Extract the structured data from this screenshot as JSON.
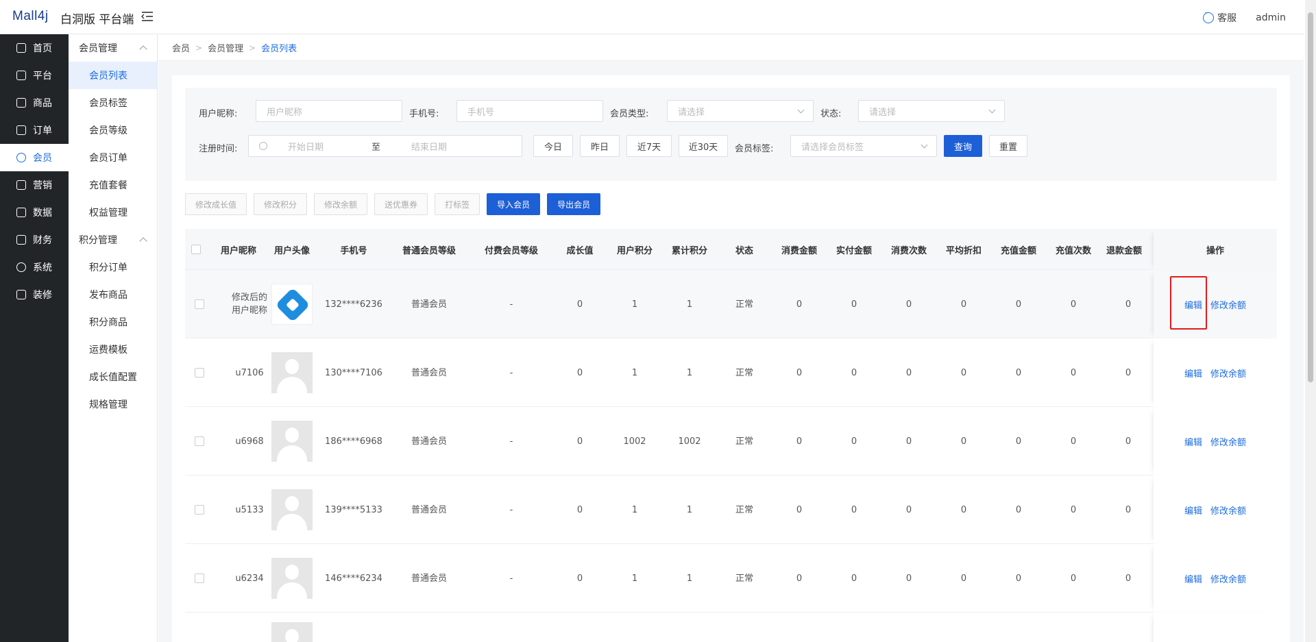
{
  "header": {
    "logo": "Mall4j",
    "subtitle": "白洞版 平台端",
    "service_label": "客服",
    "user": "admin"
  },
  "main_nav": [
    {
      "label": "首页",
      "icon": "home-icon"
    },
    {
      "label": "平台",
      "icon": "platform-icon"
    },
    {
      "label": "商品",
      "icon": "product-icon"
    },
    {
      "label": "订单",
      "icon": "order-icon"
    },
    {
      "label": "会员",
      "icon": "member-icon",
      "active": true
    },
    {
      "label": "营销",
      "icon": "marketing-icon"
    },
    {
      "label": "数据",
      "icon": "data-icon"
    },
    {
      "label": "财务",
      "icon": "finance-icon"
    },
    {
      "label": "系统",
      "icon": "system-icon"
    },
    {
      "label": "装修",
      "icon": "decorate-icon"
    }
  ],
  "sub_nav": {
    "group1": "会员管理",
    "group1_items": [
      "会员列表",
      "会员标签",
      "会员等级",
      "会员订单",
      "充值套餐",
      "权益管理"
    ],
    "group2": "积分管理",
    "group2_items": [
      "积分订单",
      "发布商品",
      "积分商品",
      "运费模板",
      "成长值配置",
      "规格管理"
    ]
  },
  "breadcrumb": [
    "会员",
    "会员管理",
    "会员列表"
  ],
  "filter": {
    "nickname_label": "用户昵称:",
    "nickname_placeholder": "用户昵称",
    "phone_label": "手机号:",
    "phone_placeholder": "手机号",
    "type_label": "会员类型:",
    "type_placeholder": "请选择",
    "status_label": "状态:",
    "status_placeholder": "请选择",
    "regtime_label": "注册时间:",
    "start_placeholder": "开始日期",
    "to": "至",
    "end_placeholder": "结束日期",
    "today": "今日",
    "yesterday": "昨日",
    "last7": "近7天",
    "last30": "近30天",
    "tag_label": "会员标签:",
    "tag_placeholder": "请选择会员标签",
    "search": "查询",
    "reset": "重置"
  },
  "toolbar": [
    "修改成长值",
    "修改积分",
    "修改余额",
    "送优惠券",
    "打标签",
    "导入会员",
    "导出会员"
  ],
  "columns": [
    "用户昵称",
    "用户头像",
    "手机号",
    "普通会员等级",
    "付费会员等级",
    "成长值",
    "用户积分",
    "累计积分",
    "状态",
    "消费金额",
    "实付金额",
    "消费次数",
    "平均折扣",
    "充值金额",
    "充值次数",
    "退款金额"
  ],
  "ops_header": "操作",
  "ops": {
    "edit": "编辑",
    "balance": "修改余额"
  },
  "rows": [
    {
      "nickname": "修改后的用户昵称",
      "phone": "132****6236",
      "level": "普通会员",
      "paid_level": "-",
      "growth": "0",
      "points": "1",
      "total_points": "1",
      "status": "正常",
      "spend": "0",
      "paid": "0",
      "count": "0",
      "discount": "0",
      "recharge": "0",
      "recharge_count": "0",
      "refund": "0"
    },
    {
      "nickname": "u7106",
      "phone": "130****7106",
      "level": "普通会员",
      "paid_level": "-",
      "growth": "0",
      "points": "1",
      "total_points": "1",
      "status": "正常",
      "spend": "0",
      "paid": "0",
      "count": "0",
      "discount": "0",
      "recharge": "0",
      "recharge_count": "0",
      "refund": "0"
    },
    {
      "nickname": "u6968",
      "phone": "186****6968",
      "level": "普通会员",
      "paid_level": "-",
      "growth": "0",
      "points": "1002",
      "total_points": "1002",
      "status": "正常",
      "spend": "0",
      "paid": "0",
      "count": "0",
      "discount": "0",
      "recharge": "0",
      "recharge_count": "0",
      "refund": "0"
    },
    {
      "nickname": "u5133",
      "phone": "139****5133",
      "level": "普通会员",
      "paid_level": "-",
      "growth": "0",
      "points": "1",
      "total_points": "1",
      "status": "正常",
      "spend": "0",
      "paid": "0",
      "count": "0",
      "discount": "0",
      "recharge": "0",
      "recharge_count": "0",
      "refund": "0"
    },
    {
      "nickname": "u6234",
      "phone": "146****6234",
      "level": "普通会员",
      "paid_level": "-",
      "growth": "0",
      "points": "1",
      "total_points": "1",
      "status": "正常",
      "spend": "0",
      "paid": "0",
      "count": "0",
      "discount": "0",
      "recharge": "0",
      "recharge_count": "0",
      "refund": "0"
    }
  ],
  "colors": {
    "accent": "#1d6ce0",
    "primary_btn": "#1d5fd6",
    "sidebar_bg": "#222528",
    "highlight": "#e3191b"
  }
}
